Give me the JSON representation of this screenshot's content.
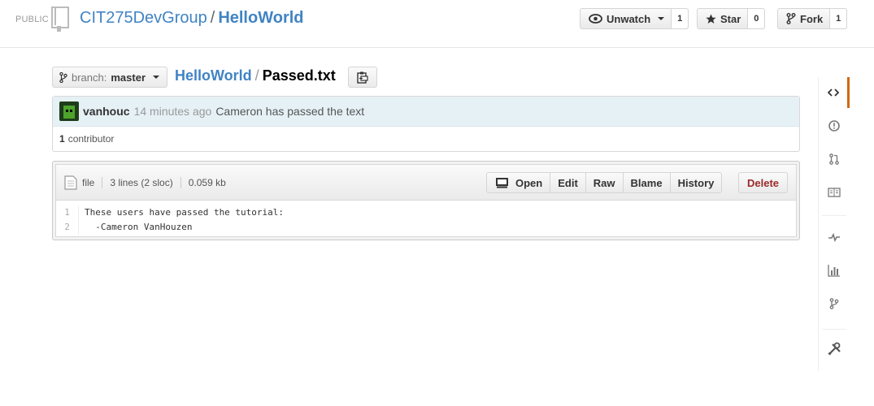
{
  "header": {
    "visibility": "PUBLIC",
    "owner": "CIT275DevGroup",
    "separator": "/",
    "repo": "HelloWorld",
    "unwatch": {
      "label": "Unwatch",
      "count": "1"
    },
    "star": {
      "label": "Star",
      "count": "0"
    },
    "fork": {
      "label": "Fork",
      "count": "1"
    }
  },
  "breadcrumb": {
    "branch_label": "branch:",
    "branch_value": "master",
    "repo": "HelloWorld",
    "separator": "/",
    "file": "Passed.txt"
  },
  "commit": {
    "author": "vanhouc",
    "time": "14 minutes ago",
    "message": "Cameron has passed the text",
    "contributors_count": "1",
    "contributors_label": "contributor"
  },
  "file": {
    "mode": "file",
    "lines_info": "3 lines (2 sloc)",
    "size": "0.059 kb",
    "buttons": {
      "open": "Open",
      "edit": "Edit",
      "raw": "Raw",
      "blame": "Blame",
      "history": "History",
      "delete": "Delete"
    },
    "line_numbers": [
      "1",
      "2"
    ],
    "lines": [
      "These users have passed the tutorial:",
      "  -Cameron VanHouzen"
    ]
  },
  "sidebar_nav": {
    "items": [
      "code-icon",
      "issues-icon",
      "pull-requests-icon",
      "wiki-icon",
      "pulse-icon",
      "graphs-icon",
      "network-icon",
      "settings-icon"
    ]
  },
  "colors": {
    "link": "#4183c4",
    "active_nav": "#d26911",
    "delete": "#9a2a2a",
    "commit_bg": "#e6f1f6"
  }
}
